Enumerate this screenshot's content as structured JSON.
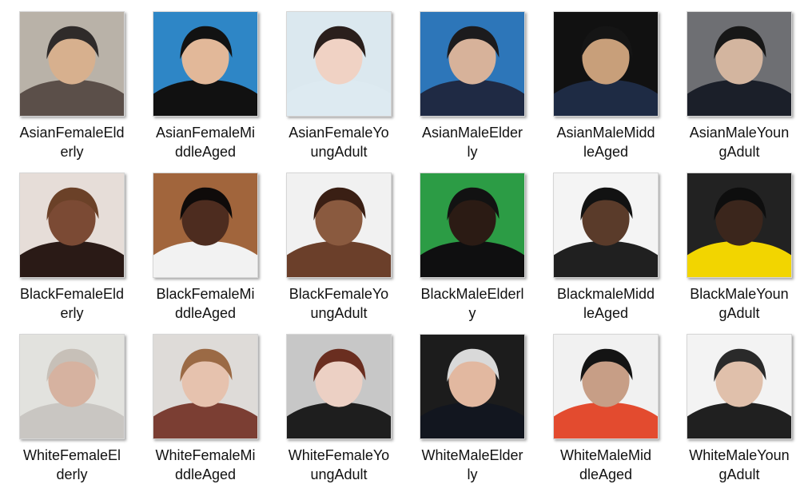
{
  "thumbnails": [
    {
      "line1": "AsianFemaleEld",
      "line2": "erly",
      "icon": "photo-thumbnail",
      "bg": "#b9b2a8",
      "skin": "#d7b08e",
      "hair": "#2f2b2a",
      "cloth": "#5b4f49"
    },
    {
      "line1": "AsianFemaleMi",
      "line2": "ddleAged",
      "icon": "photo-thumbnail",
      "bg": "#2e86c6",
      "skin": "#e2b899",
      "hair": "#121212",
      "cloth": "#111111"
    },
    {
      "line1": "AsianFemaleYo",
      "line2": "ungAdult",
      "icon": "photo-thumbnail",
      "bg": "#dbe8ef",
      "skin": "#f0d2c4",
      "hair": "#2a1f1c",
      "cloth": "#ddeaf1"
    },
    {
      "line1": "AsianMaleElder",
      "line2": "ly",
      "icon": "photo-thumbnail",
      "bg": "#2d76b9",
      "skin": "#d7b29a",
      "hair": "#1c1b1d",
      "cloth": "#1f2a44"
    },
    {
      "line1": "AsianMaleMidd",
      "line2": "leAged",
      "icon": "photo-thumbnail",
      "bg": "#111111",
      "skin": "#c89f7a",
      "hair": "#151515",
      "cloth": "#1e2b44"
    },
    {
      "line1": "AsianMaleYoun",
      "line2": "gAdult",
      "icon": "photo-thumbnail",
      "bg": "#6e6f73",
      "skin": "#d3b59f",
      "hair": "#171717",
      "cloth": "#1b1f29"
    },
    {
      "line1": "BlackFemaleEld",
      "line2": "erly",
      "icon": "photo-thumbnail",
      "bg": "#e6ddd8",
      "skin": "#7b4a34",
      "hair": "#6b4128",
      "cloth": "#2a1a16"
    },
    {
      "line1": "BlackFemaleMi",
      "line2": "ddleAged",
      "icon": "photo-thumbnail",
      "bg": "#a1653c",
      "skin": "#4d2c1f",
      "hair": "#0f0b0a",
      "cloth": "#f2f2f2"
    },
    {
      "line1": "BlackFemaleYo",
      "line2": "ungAdult",
      "icon": "photo-thumbnail",
      "bg": "#f1f1f1",
      "skin": "#8a5a3f",
      "hair": "#3a1f14",
      "cloth": "#6b3f2a"
    },
    {
      "line1": "BlackMaleElderl",
      "line2": "y",
      "icon": "photo-thumbnail",
      "bg": "#2c9c45",
      "skin": "#2b1b14",
      "hair": "#121212",
      "cloth": "#0f0f10"
    },
    {
      "line1": "BlackmaleMidd",
      "line2": "leAged",
      "icon": "photo-thumbnail",
      "bg": "#f4f4f4",
      "skin": "#5a3b2a",
      "hair": "#121212",
      "cloth": "#202020"
    },
    {
      "line1": "BlackMaleYoun",
      "line2": "gAdult",
      "icon": "photo-thumbnail",
      "bg": "#222222",
      "skin": "#3b261c",
      "hair": "#0e0e0e",
      "cloth": "#f2d500"
    },
    {
      "line1": "WhiteFemaleEl",
      "line2": "derly",
      "icon": "photo-thumbnail",
      "bg": "#e2e2de",
      "skin": "#d6b2a0",
      "hair": "#c7c0b8",
      "cloth": "#c9c6c2"
    },
    {
      "line1": "WhiteFemaleMi",
      "line2": "ddleAged",
      "icon": "photo-thumbnail",
      "bg": "#dedbd8",
      "skin": "#e6c2ae",
      "hair": "#9b6a45",
      "cloth": "#7b3e33"
    },
    {
      "line1": "WhiteFemaleYo",
      "line2": "ungAdult",
      "icon": "photo-thumbnail",
      "bg": "#c7c7c7",
      "skin": "#ecd0c4",
      "hair": "#6a2e20",
      "cloth": "#1e1e1e"
    },
    {
      "line1": "WhiteMaleElder",
      "line2": "ly",
      "icon": "photo-thumbnail",
      "bg": "#1c1c1c",
      "skin": "#e2b8a0",
      "hair": "#d9d9d9",
      "cloth": "#12161f"
    },
    {
      "line1": "WhiteMaleMid",
      "line2": "dleAged",
      "icon": "photo-thumbnail",
      "bg": "#f1f1f1",
      "skin": "#c79e86",
      "hair": "#141414",
      "cloth": "#e34b2f"
    },
    {
      "line1": "WhiteMaleYoun",
      "line2": "gAdult",
      "icon": "photo-thumbnail",
      "bg": "#f3f3f3",
      "skin": "#e0c0ab",
      "hair": "#2a2a2a",
      "cloth": "#202020"
    }
  ]
}
